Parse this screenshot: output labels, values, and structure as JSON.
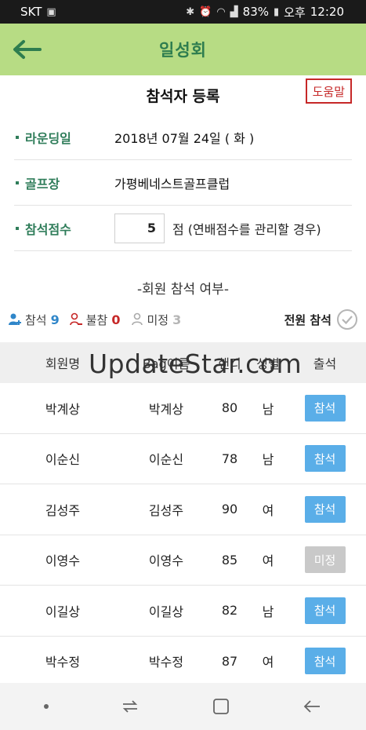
{
  "status_bar": {
    "carrier": "SKT",
    "battery": "83%",
    "ampm": "오후",
    "time": "12:20"
  },
  "app_bar": {
    "title": "일성회"
  },
  "page": {
    "title": "참석자 등록",
    "help_label": "도움말"
  },
  "info": {
    "round_date_label": "라운딩일",
    "round_date_value": "2018년 07월 24일 ( 화 )",
    "course_label": "골프장",
    "course_value": "가평베네스트골프클럽",
    "score_label": "참석점수",
    "score_value": "5",
    "score_unit": "점 (연배점수를 관리할 경우)"
  },
  "attendance": {
    "section_title": "-회원 참석 여부-",
    "attend_label": "참석",
    "attend_count": "9",
    "absent_label": "불참",
    "absent_count": "0",
    "undecided_label": "미정",
    "undecided_count": "3",
    "all_attend_label": "전원 참석"
  },
  "table": {
    "headers": [
      "회원명",
      "Bag이름",
      "핸디",
      "성별",
      "출석"
    ],
    "watermark": "UpdateStar.com",
    "rows": [
      {
        "name": "박계상",
        "bag": "박계상",
        "handicap": "80",
        "gender": "남",
        "status": "참석",
        "on": true
      },
      {
        "name": "이순신",
        "bag": "이순신",
        "handicap": "78",
        "gender": "남",
        "status": "참석",
        "on": true
      },
      {
        "name": "김성주",
        "bag": "김성주",
        "handicap": "90",
        "gender": "여",
        "status": "참석",
        "on": true
      },
      {
        "name": "이영수",
        "bag": "이영수",
        "handicap": "85",
        "gender": "여",
        "status": "미정",
        "on": false
      },
      {
        "name": "이길상",
        "bag": "이길상",
        "handicap": "82",
        "gender": "남",
        "status": "참석",
        "on": true
      },
      {
        "name": "박수정",
        "bag": "박수정",
        "handicap": "87",
        "gender": "여",
        "status": "참석",
        "on": true
      }
    ]
  },
  "colors": {
    "app_bar": "#b7dc84",
    "accent_green": "#2f7d5a",
    "attend_blue": "#5aaee8",
    "help_red": "#c62828"
  }
}
